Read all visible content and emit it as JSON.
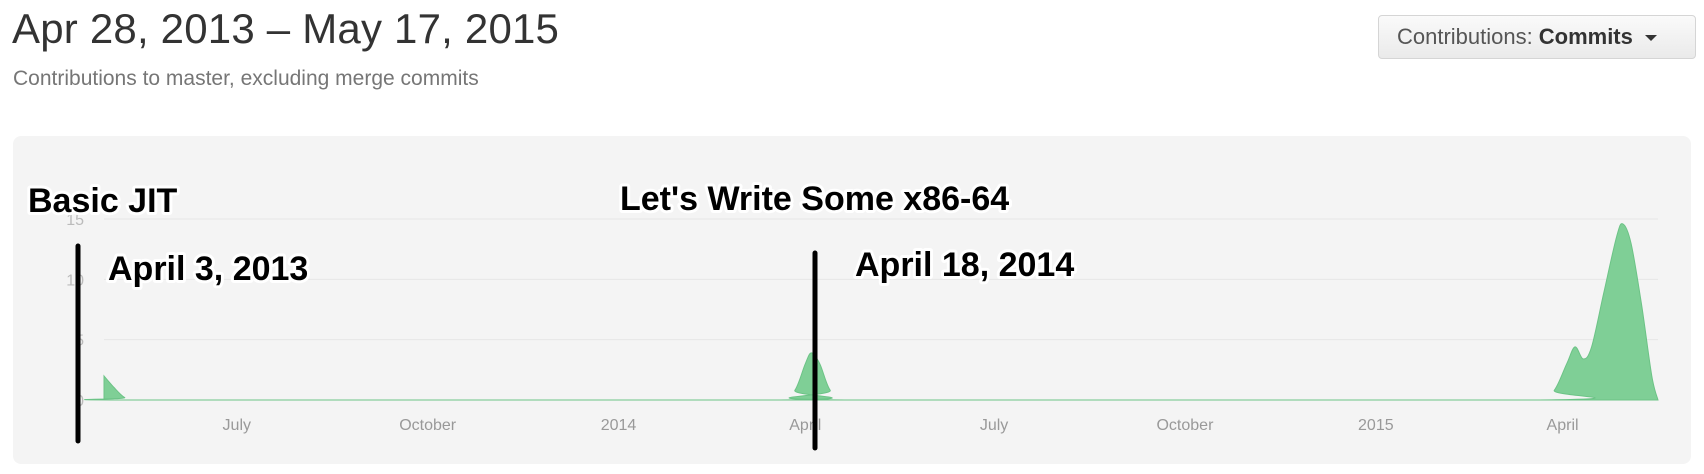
{
  "header": {
    "range_title": "Apr 28, 2013 – May 17, 2015",
    "subtitle": "Contributions to master, excluding merge commits"
  },
  "contributions_select": {
    "label": "Contributions:",
    "value": "Commits"
  },
  "colors": {
    "area_fill": "#7fcf96",
    "panel_bg": "#f4f4f4"
  },
  "chart_data": {
    "type": "area",
    "title": "",
    "xlabel": "",
    "ylabel": "",
    "ylim": [
      0,
      15
    ],
    "yticks": [
      0,
      5,
      10,
      15
    ],
    "xlim": [
      "2013-04-28",
      "2015-05-17"
    ],
    "xticks": [
      {
        "date": "2013-07-01",
        "label": "July"
      },
      {
        "date": "2013-10-01",
        "label": "October"
      },
      {
        "date": "2014-01-01",
        "label": "2014"
      },
      {
        "date": "2014-04-01",
        "label": "April"
      },
      {
        "date": "2014-07-01",
        "label": "July"
      },
      {
        "date": "2014-10-01",
        "label": "October"
      },
      {
        "date": "2015-01-01",
        "label": "2015"
      },
      {
        "date": "2015-04-01",
        "label": "April"
      }
    ],
    "grid": true,
    "series": [
      {
        "points": [
          [
            "2013-04-28",
            2.0
          ],
          [
            "2013-05-03",
            1.0
          ],
          [
            "2013-05-08",
            0.2
          ],
          [
            "2013-05-13",
            0
          ],
          [
            "2014-03-20",
            0
          ],
          [
            "2014-03-27",
            0.8
          ],
          [
            "2014-04-01",
            3.0
          ],
          [
            "2014-04-04",
            3.9
          ],
          [
            "2014-04-08",
            3.0
          ],
          [
            "2014-04-13",
            0.8
          ],
          [
            "2014-04-20",
            0
          ],
          [
            "2015-03-21",
            0
          ],
          [
            "2015-03-28",
            0.8
          ],
          [
            "2015-04-03",
            3.0
          ],
          [
            "2015-04-07",
            4.4
          ],
          [
            "2015-04-11",
            3.4
          ],
          [
            "2015-04-15",
            4.4
          ],
          [
            "2015-04-21",
            9.0
          ],
          [
            "2015-04-27",
            13.5
          ],
          [
            "2015-04-30",
            14.6
          ],
          [
            "2015-05-04",
            13.0
          ],
          [
            "2015-05-09",
            8.0
          ],
          [
            "2015-05-14",
            2.0
          ],
          [
            "2015-05-17",
            0
          ]
        ]
      }
    ],
    "annotations": [
      {
        "title": "Basic JIT",
        "date_label": "April 3, 2013",
        "marker_date": "2013-04-03"
      },
      {
        "title": "Let's Write Some x86-64",
        "date_label": "April 18, 2014",
        "marker_date": "2014-04-18"
      }
    ]
  }
}
